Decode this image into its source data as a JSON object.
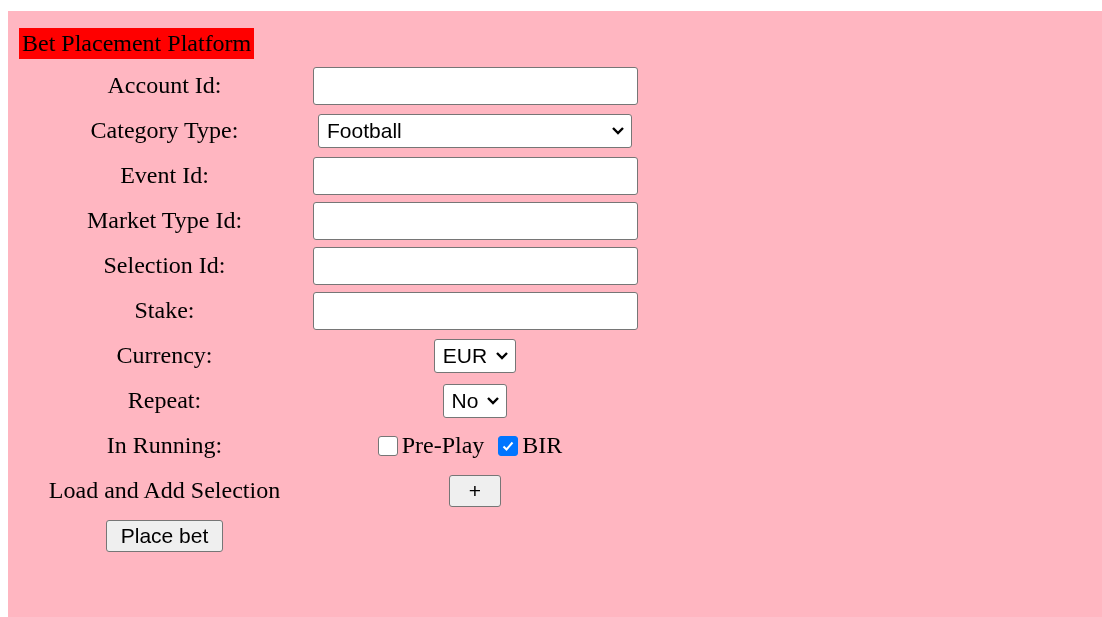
{
  "title": "Bet Placement Platform",
  "rows": [
    {
      "kind": "text",
      "label": "Account Id:"
    },
    {
      "kind": "select",
      "label": "Category Type:",
      "value": "Football"
    },
    {
      "kind": "text",
      "label": "Event Id:"
    },
    {
      "kind": "text",
      "label": "Market Type Id:"
    },
    {
      "kind": "text",
      "label": "Selection Id:"
    },
    {
      "kind": "text",
      "label": "Stake:"
    },
    {
      "kind": "select",
      "label": "Currency:",
      "value": "EUR"
    },
    {
      "kind": "select",
      "label": "Repeat:",
      "value": "No"
    },
    {
      "kind": "checks",
      "label": "In Running:",
      "options": [
        {
          "label": "Pre-Play",
          "checked": false
        },
        {
          "label": "BIR",
          "checked": true
        }
      ]
    },
    {
      "kind": "button",
      "label": "Load and Add Selection",
      "button": "+"
    }
  ],
  "submit": "Place bet"
}
